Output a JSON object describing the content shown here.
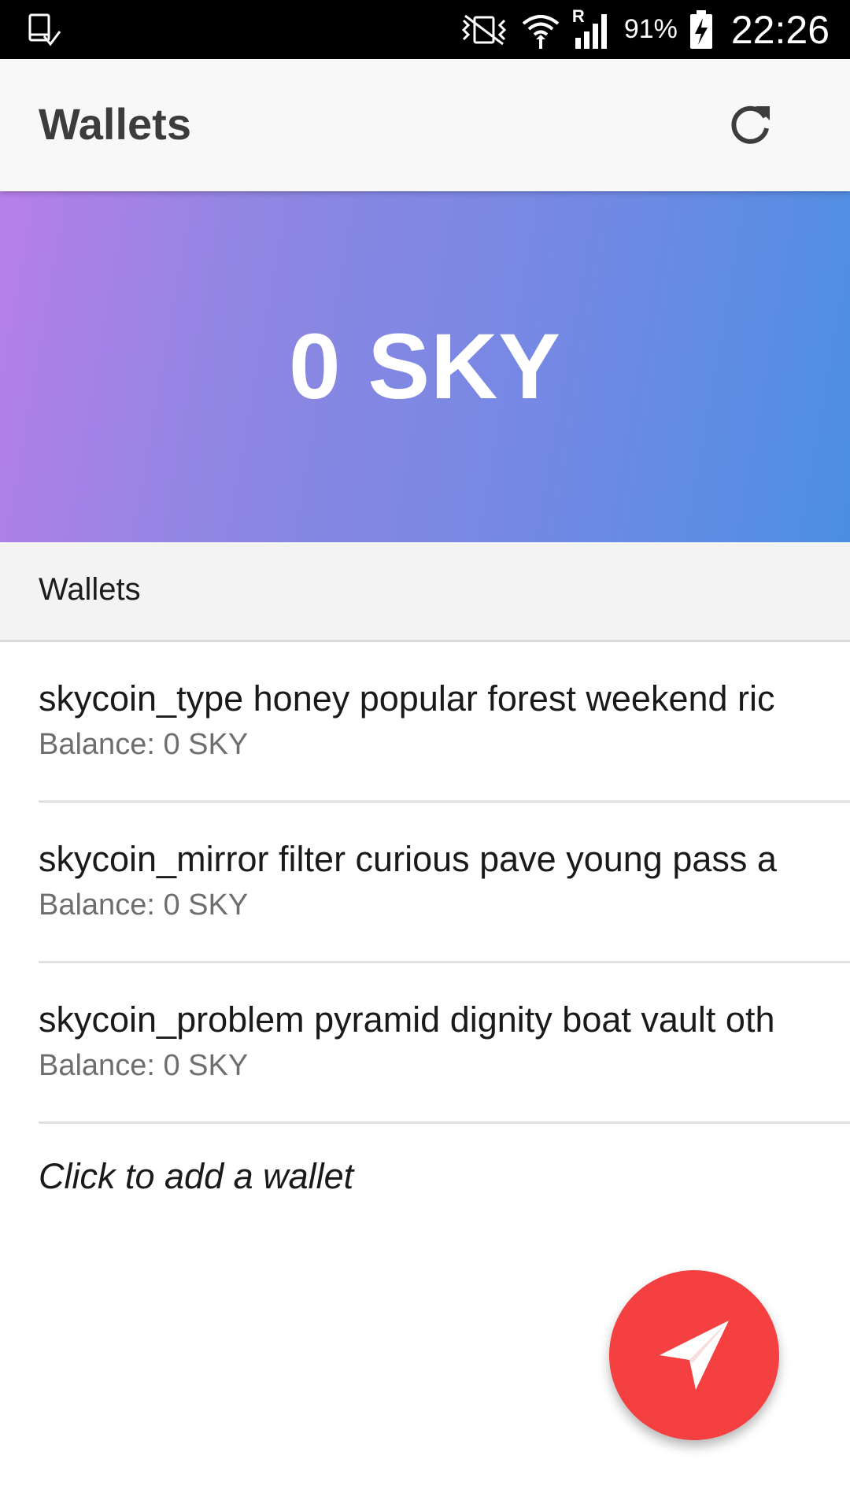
{
  "status_bar": {
    "left_icon": "device-download-icon",
    "mute_icon": "vibrate-mute-icon",
    "wifi_icon": "wifi-icon",
    "roaming_indicator": "R",
    "signal_icon": "signal-icon",
    "battery_percent": "91%",
    "battery_icon": "battery-charging-icon",
    "time": "22:26"
  },
  "app_bar": {
    "title": "Wallets",
    "refresh_icon": "refresh-icon"
  },
  "hero": {
    "total_balance": "0 SKY",
    "gradient_colors": [
      "#b67fe9",
      "#4b8fe2"
    ]
  },
  "section": {
    "title": "Wallets"
  },
  "wallets": [
    {
      "name": "skycoin_type honey popular forest weekend ric",
      "balance": "Balance: 0 SKY"
    },
    {
      "name": "skycoin_mirror filter curious pave young pass a",
      "balance": "Balance: 0 SKY"
    },
    {
      "name": "skycoin_problem pyramid dignity boat vault oth",
      "balance": "Balance: 0 SKY"
    }
  ],
  "add_wallet_label": "Click to add a wallet",
  "fab": {
    "icon": "send-icon",
    "color": "#f44040"
  }
}
